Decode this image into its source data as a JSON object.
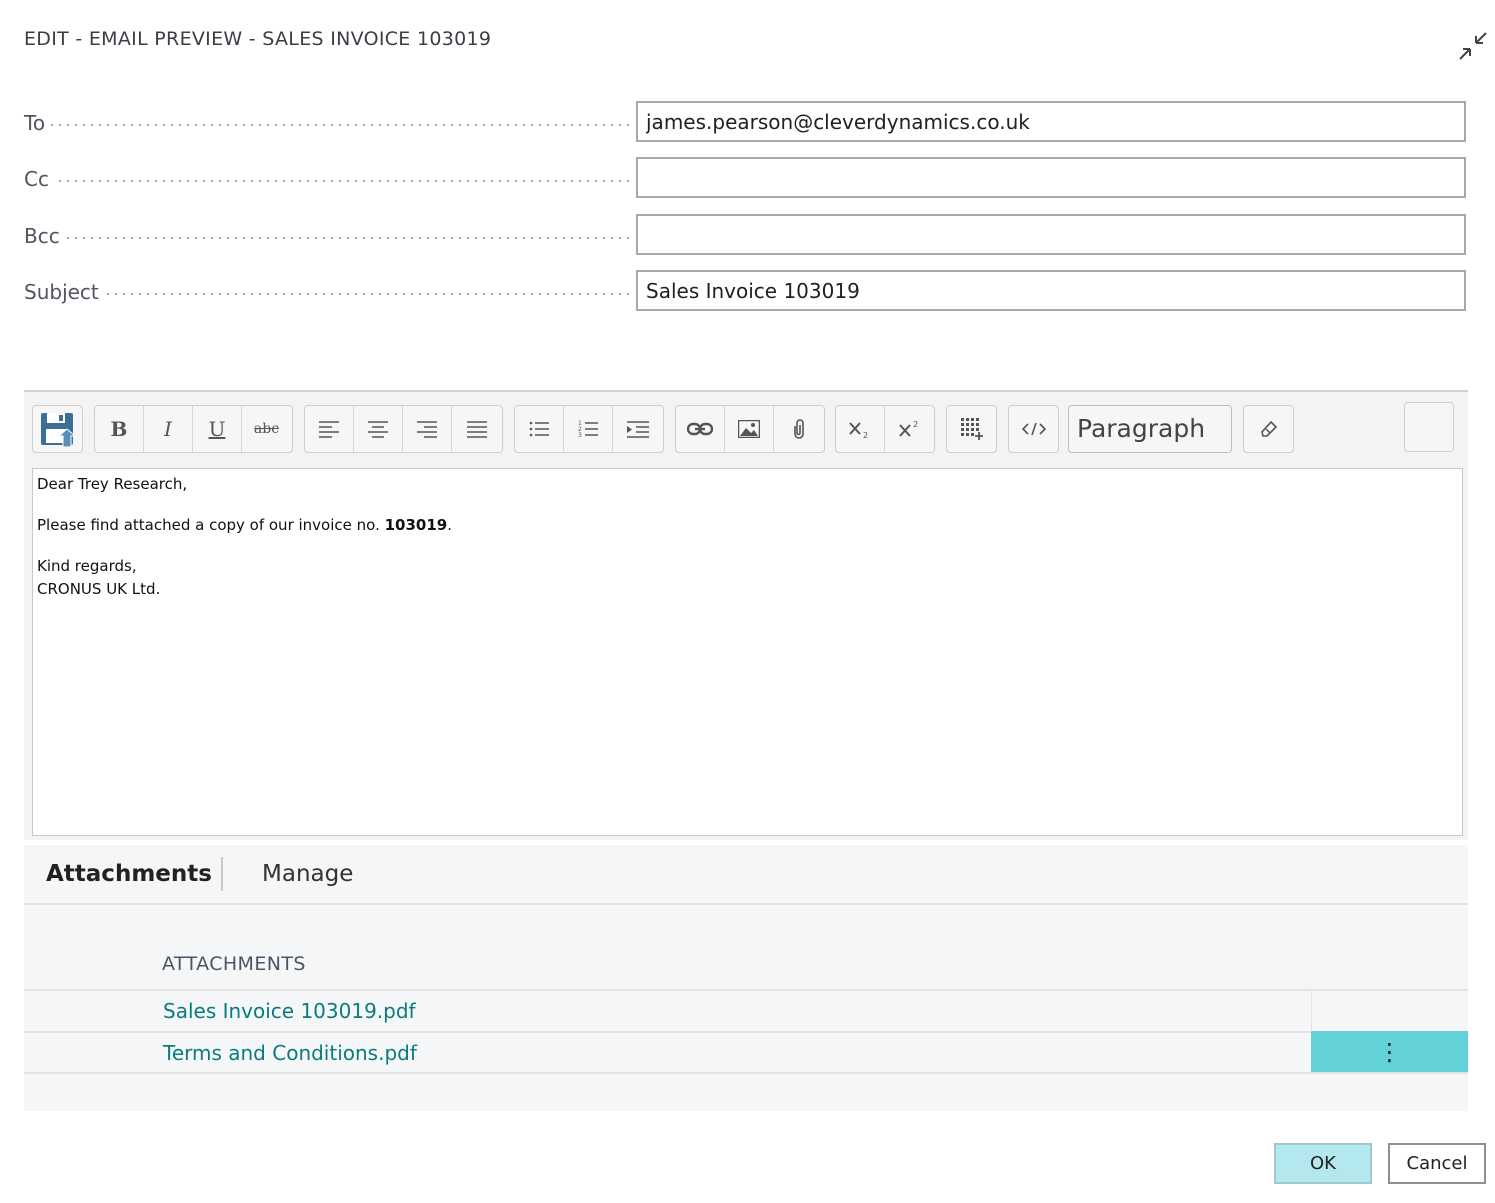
{
  "dialog": {
    "title": "EDIT - EMAIL PREVIEW - SALES INVOICE 103019"
  },
  "fields": {
    "to": {
      "label": "To",
      "value": "james.pearson@cleverdynamics.co.uk"
    },
    "cc": {
      "label": "Cc",
      "value": ""
    },
    "bcc": {
      "label": "Bcc",
      "value": ""
    },
    "subject": {
      "label": "Subject",
      "value": "Sales Invoice 103019"
    }
  },
  "toolbar": {
    "bold_glyph": "B",
    "italic_glyph": "I",
    "underline_glyph": "U",
    "strike_glyph": "abc",
    "format_select": "Paragraph",
    "icons": [
      "save-icon",
      "bold-icon",
      "italic-icon",
      "underline-icon",
      "strikethrough-icon",
      "align-left-icon",
      "align-center-icon",
      "align-right-icon",
      "justify-icon",
      "bullet-list-icon",
      "numbered-list-icon",
      "indent-icon",
      "link-icon",
      "image-icon",
      "attach-icon",
      "subscript-icon",
      "superscript-icon",
      "table-icon",
      "code-icon",
      "eraser-icon"
    ]
  },
  "body": {
    "greeting": "Dear Trey Research,",
    "line_prefix": "Please find attached a copy of our invoice no. ",
    "invoice_no": "103019",
    "line_suffix": ".",
    "closing": "Kind regards,",
    "signature": "CRONUS UK Ltd."
  },
  "attachments_panel": {
    "tabs": [
      {
        "label": "Attachments",
        "active": true
      },
      {
        "label": "Manage",
        "active": false
      }
    ],
    "column_header": "ATTACHMENTS",
    "files": [
      {
        "name": "Sales Invoice 103019.pdf",
        "selected": false
      },
      {
        "name": "Terms and Conditions.pdf",
        "selected": true
      }
    ],
    "row_menu_glyph": "⋮"
  },
  "buttons": {
    "ok": "OK",
    "cancel": "Cancel"
  },
  "colors": {
    "link": "#0a7b7e",
    "selected_row_menu": "#63d1d8",
    "ok_button": "#b3e9ee"
  }
}
